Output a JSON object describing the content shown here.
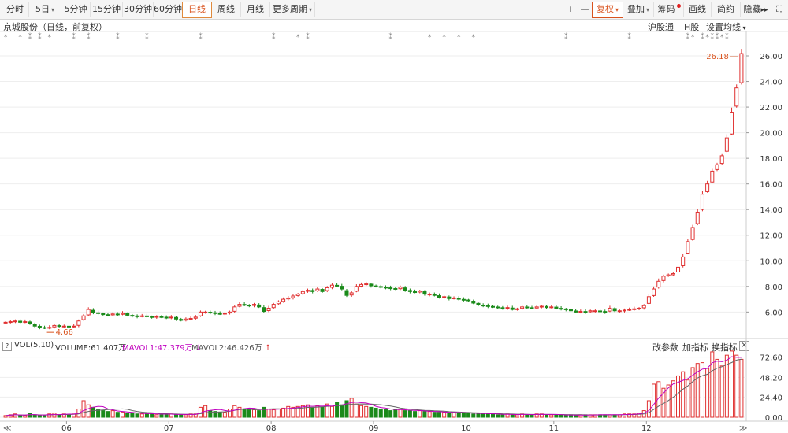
{
  "toolbar": {
    "periods": [
      "分时",
      "5日",
      "5分钟",
      "15分钟",
      "30分钟",
      "60分钟",
      "日线",
      "周线",
      "月线",
      "更多周期"
    ],
    "selected": "日线",
    "right_buttons": [
      "+",
      "—",
      "复权",
      "叠加",
      "筹码",
      "画线",
      "简约",
      "隐藏",
      "⛶"
    ]
  },
  "stock_title": "京城股份（日线，前复权）",
  "top_right_links": [
    "沪股通",
    "H股",
    "设置均线"
  ],
  "price_labels": {
    "high": "26.18",
    "low": "4.66"
  },
  "vol_panel": {
    "title": "VOL(5,10)",
    "volume_label": "VOLUME:61.407万",
    "mavol1_label": "MAVOL1:47.379万",
    "mavol2_label": "MAVOL2:46.426万",
    "buttons": [
      "改参数",
      "加指标",
      "换指标"
    ],
    "close": "×"
  },
  "x_axis": {
    "months": [
      "06",
      "07",
      "08",
      "09",
      "10",
      "11",
      "12"
    ]
  },
  "colors": {
    "up": "#e03030",
    "down": "#1a8a1a",
    "mavol1": "#c000c0",
    "mavol2": "#666666",
    "grid": "#eeeeee",
    "accent": "#d9531e"
  },
  "chart_data": {
    "type": "candlestick",
    "title": "京城股份（日线，前复权）",
    "price_axis": {
      "ticks": [
        6.0,
        8.0,
        10.0,
        12.0,
        14.0,
        16.0,
        18.0,
        20.0,
        22.0,
        24.0,
        26.0
      ],
      "min": 4.3,
      "max": 26.8
    },
    "volume_axis": {
      "ticks": [
        0.0,
        24.4,
        48.2,
        72.6
      ],
      "max": 78
    },
    "annotations": {
      "max_price": 26.18,
      "min_price": 4.66
    },
    "closes": [
      5.2,
      5.25,
      5.3,
      5.2,
      5.25,
      5.1,
      4.9,
      4.8,
      4.75,
      4.8,
      4.95,
      4.9,
      4.9,
      4.85,
      4.9,
      5.3,
      5.7,
      6.2,
      5.95,
      5.9,
      5.8,
      5.75,
      5.85,
      5.8,
      5.9,
      5.75,
      5.7,
      5.65,
      5.7,
      5.65,
      5.6,
      5.65,
      5.6,
      5.55,
      5.6,
      5.45,
      5.35,
      5.45,
      5.5,
      5.6,
      6.0,
      6.0,
      5.95,
      5.9,
      5.85,
      5.9,
      6.0,
      6.4,
      6.6,
      6.55,
      6.5,
      6.6,
      6.4,
      6.05,
      6.3,
      6.6,
      6.8,
      7.0,
      7.1,
      7.25,
      7.4,
      7.6,
      7.7,
      7.6,
      7.8,
      7.6,
      7.9,
      8.1,
      8.05,
      7.8,
      7.3,
      7.5,
      8.0,
      8.15,
      8.2,
      8.05,
      8.0,
      7.95,
      7.9,
      7.85,
      7.8,
      7.95,
      7.7,
      7.6,
      7.55,
      7.65,
      7.4,
      7.4,
      7.3,
      7.15,
      7.2,
      7.05,
      7.1,
      7.0,
      6.95,
      6.9,
      6.7,
      6.55,
      6.5,
      6.45,
      6.4,
      6.35,
      6.3,
      6.35,
      6.2,
      6.25,
      6.4,
      6.35,
      6.3,
      6.4,
      6.45,
      6.35,
      6.4,
      6.3,
      6.25,
      6.2,
      6.1,
      6.0,
      6.05,
      6.0,
      6.1,
      6.1,
      6.05,
      6.0,
      6.3,
      6.1,
      6.1,
      6.15,
      6.2,
      6.25,
      6.3,
      6.5,
      7.2,
      7.8,
      8.4,
      8.8,
      8.9,
      9.0,
      9.5,
      10.3,
      11.5,
      12.6,
      13.8,
      15.2,
      16.0,
      17.0,
      17.5,
      18.2,
      19.6,
      21.6,
      23.5,
      26.18
    ],
    "volumes": [
      2,
      3,
      4,
      2,
      2,
      5,
      3,
      2,
      2,
      4,
      5,
      3,
      4,
      3,
      4,
      10,
      20,
      15,
      12,
      9,
      8,
      7,
      8,
      6,
      6,
      5,
      5,
      4,
      4,
      4,
      5,
      3,
      3,
      4,
      4,
      3,
      3,
      3,
      4,
      4,
      12,
      14,
      8,
      7,
      6,
      6,
      10,
      14,
      12,
      10,
      9,
      9,
      8,
      12,
      10,
      9,
      10,
      11,
      13,
      12,
      13,
      14,
      15,
      12,
      14,
      12,
      16,
      13,
      18,
      15,
      20,
      23,
      16,
      14,
      13,
      12,
      11,
      9,
      10,
      8,
      9,
      10,
      8,
      8,
      7,
      8,
      7,
      7,
      6,
      6,
      6,
      5,
      6,
      5,
      5,
      5,
      4,
      5,
      4,
      4,
      4,
      3,
      3,
      4,
      3,
      3,
      4,
      3,
      3,
      4,
      4,
      3,
      3,
      3,
      3,
      2,
      3,
      2,
      3,
      3,
      3,
      3,
      3,
      3,
      3,
      3,
      3,
      4,
      4,
      4,
      5,
      8,
      20,
      40,
      43,
      35,
      39,
      44,
      50,
      55,
      45,
      60,
      65,
      66,
      59,
      79,
      70,
      62,
      75,
      80,
      75,
      70
    ]
  }
}
